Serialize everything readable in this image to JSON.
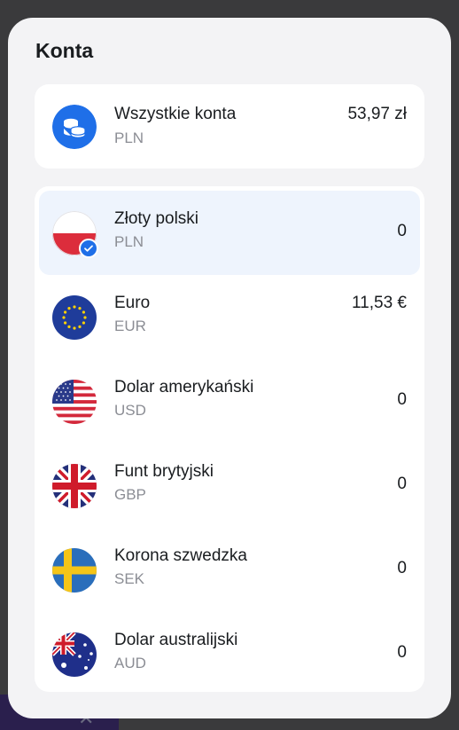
{
  "modal": {
    "title": "Konta"
  },
  "all_accounts": {
    "name": "Wszystkie konta",
    "code": "PLN",
    "amount": "53,97 zł",
    "icon": "coins-icon"
  },
  "accounts": [
    {
      "name": "Złoty polski",
      "code": "PLN",
      "amount": "0",
      "icon": "poland-flag-icon",
      "selected": true
    },
    {
      "name": "Euro",
      "code": "EUR",
      "amount": "11,53 €",
      "icon": "eu-flag-icon",
      "selected": false
    },
    {
      "name": "Dolar amerykański",
      "code": "USD",
      "amount": "0",
      "icon": "usa-flag-icon",
      "selected": false
    },
    {
      "name": "Funt brytyjski",
      "code": "GBP",
      "amount": "0",
      "icon": "uk-flag-icon",
      "selected": false
    },
    {
      "name": "Korona szwedzka",
      "code": "SEK",
      "amount": "0",
      "icon": "sweden-flag-icon",
      "selected": false
    },
    {
      "name": "Dolar australijski",
      "code": "AUD",
      "amount": "0",
      "icon": "australia-flag-icon",
      "selected": false
    }
  ],
  "colors": {
    "accent": "#1f6fe8",
    "selected_row": "#eef4fd"
  }
}
